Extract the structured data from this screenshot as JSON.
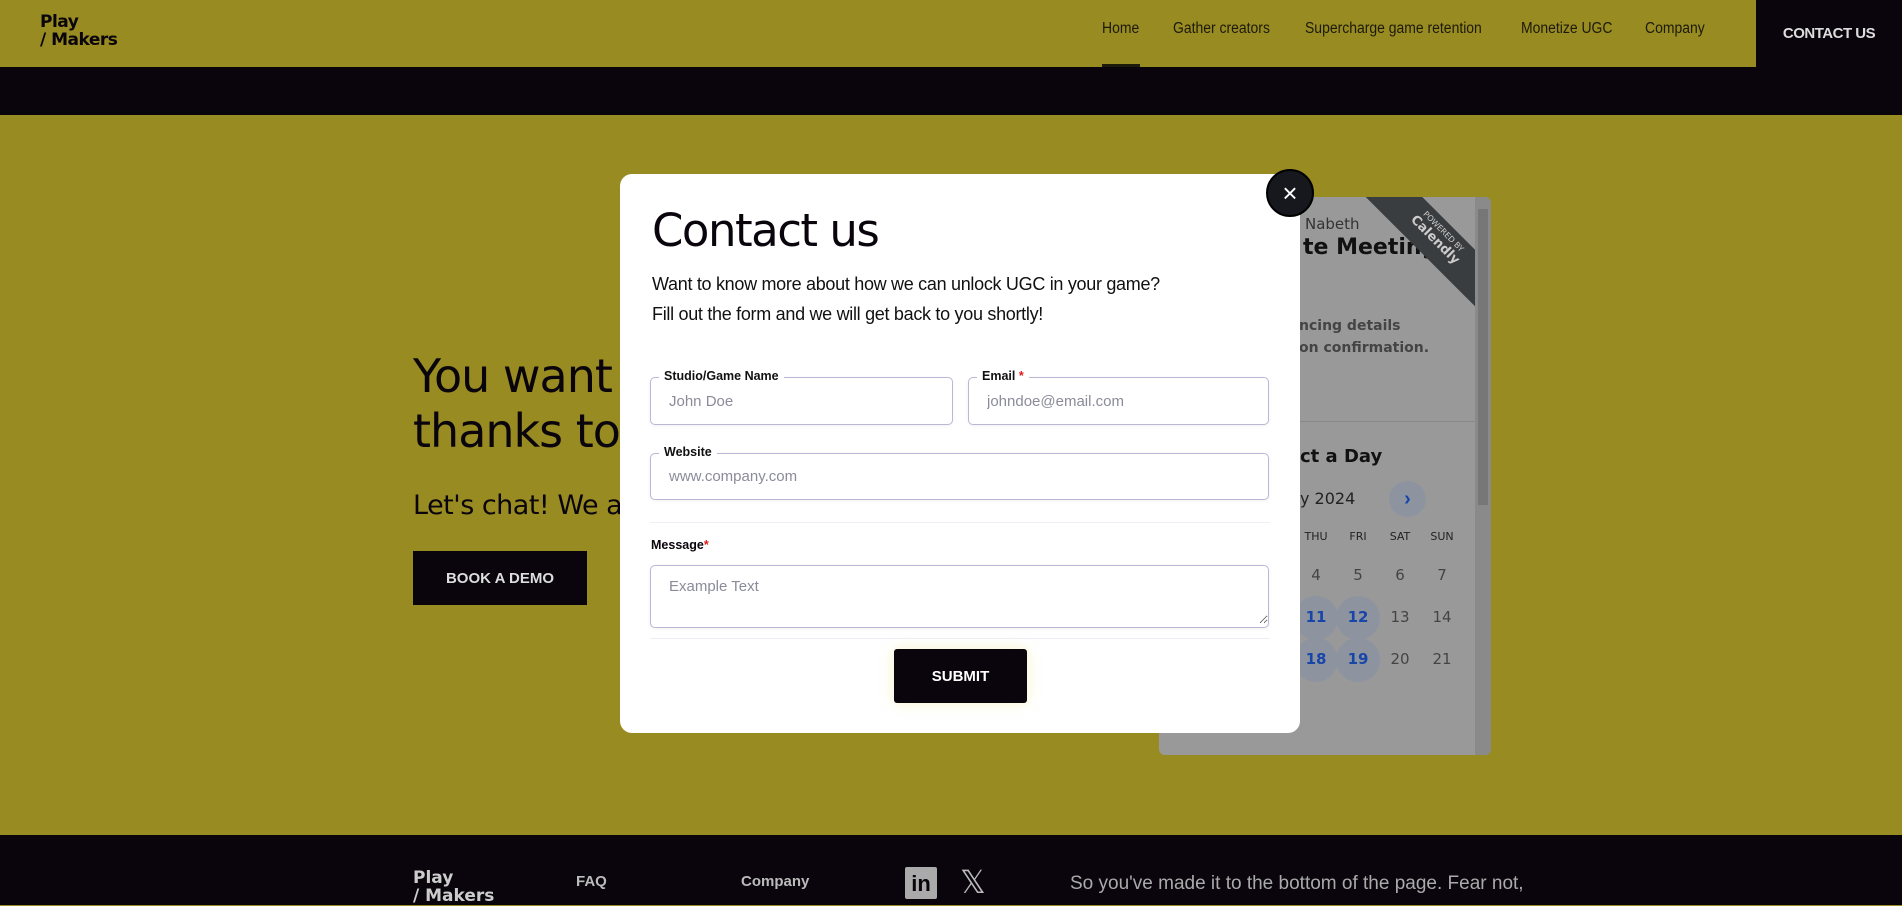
{
  "header": {
    "logo": "Play\n/Makers",
    "logo_line1": "Play",
    "logo_line2": "/ Makers",
    "nav": [
      "Home",
      "Gather creators",
      "Supercharge game retention",
      "Monetize UGC",
      "Company"
    ],
    "active": "Home",
    "contact": "CONTACT US"
  },
  "hero": {
    "line1": "You want to",
    "line2": "thanks to U",
    "sub": "Let's chat! We a",
    "button": "BOOK A DEMO"
  },
  "calendly": {
    "host": "Nabeth",
    "title": "te Meeting",
    "desc1": "ncing details",
    "desc2": "on confirmation.",
    "select": "ct a Day",
    "month": "y 2024",
    "ribbon_small": "POWERED BY",
    "ribbon_brand": "Calendly",
    "weekdays": [
      "THU",
      "FRI",
      "SAT",
      "SUN"
    ],
    "rows": [
      [
        "4",
        "5",
        "6",
        "7"
      ],
      [
        "11",
        "12",
        "13",
        "14"
      ],
      [
        "18",
        "19",
        "20",
        "21"
      ]
    ],
    "available": [
      "11",
      "12",
      "18",
      "19"
    ],
    "colors": {
      "available": "#1746a8"
    }
  },
  "modal": {
    "title": "Contact us",
    "sub1": "Want to know more about how we can unlock UGC in your game?",
    "sub2": "Fill out the form and we will get back to you shortly!",
    "studio_label": "Studio/Game Name",
    "studio_placeholder": "John Doe",
    "email_label": "Email",
    "email_placeholder": "johndoe@email.com",
    "required": "*",
    "website_label": "Website",
    "website_placeholder": "www.company.com",
    "message_label": "Message",
    "message_placeholder": "Example Text",
    "submit": "SUBMIT",
    "close": "×"
  },
  "footer": {
    "logo_line1": "Play",
    "logo_line2": "/ Makers",
    "faq": "FAQ",
    "company": "Company",
    "linkedin": "in",
    "x": "𝕏",
    "text": "So you've made it to the bottom of the page. Fear not,"
  },
  "colors": {
    "brand": "#988b22",
    "dark": "#0a050c"
  }
}
